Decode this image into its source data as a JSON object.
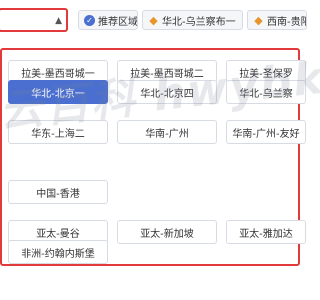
{
  "top_tabs": [
    {
      "label": "推荐区域",
      "icon": "recommend-icon"
    },
    {
      "label": "华北-乌兰察布一",
      "icon": "region-icon"
    },
    {
      "label": "西南-贵阳",
      "icon": "region-icon"
    }
  ],
  "regions": [
    {
      "label": "拉美-墨西哥城一"
    },
    {
      "label": "拉美-墨西哥城二"
    },
    {
      "label": "拉美-圣保罗"
    },
    {
      "label": "华北-北京一",
      "selected": true
    },
    {
      "label": "华北-北京四"
    },
    {
      "label": "华北-乌兰察"
    },
    {
      "label": "华东-上海二"
    },
    {
      "label": "华南-广州"
    },
    {
      "label": "华南-广州-友好"
    },
    {
      "label": "中国-香港"
    },
    {
      "label": "亚太-曼谷"
    },
    {
      "label": "亚太-新加坡"
    },
    {
      "label": "亚太-雅加达"
    },
    {
      "label": "非洲-约翰内斯堡"
    }
  ],
  "watermark": "云百科 hwybk.com",
  "colors": {
    "accent": "#4a6fd1",
    "highlight_border": "#e23a3a"
  }
}
